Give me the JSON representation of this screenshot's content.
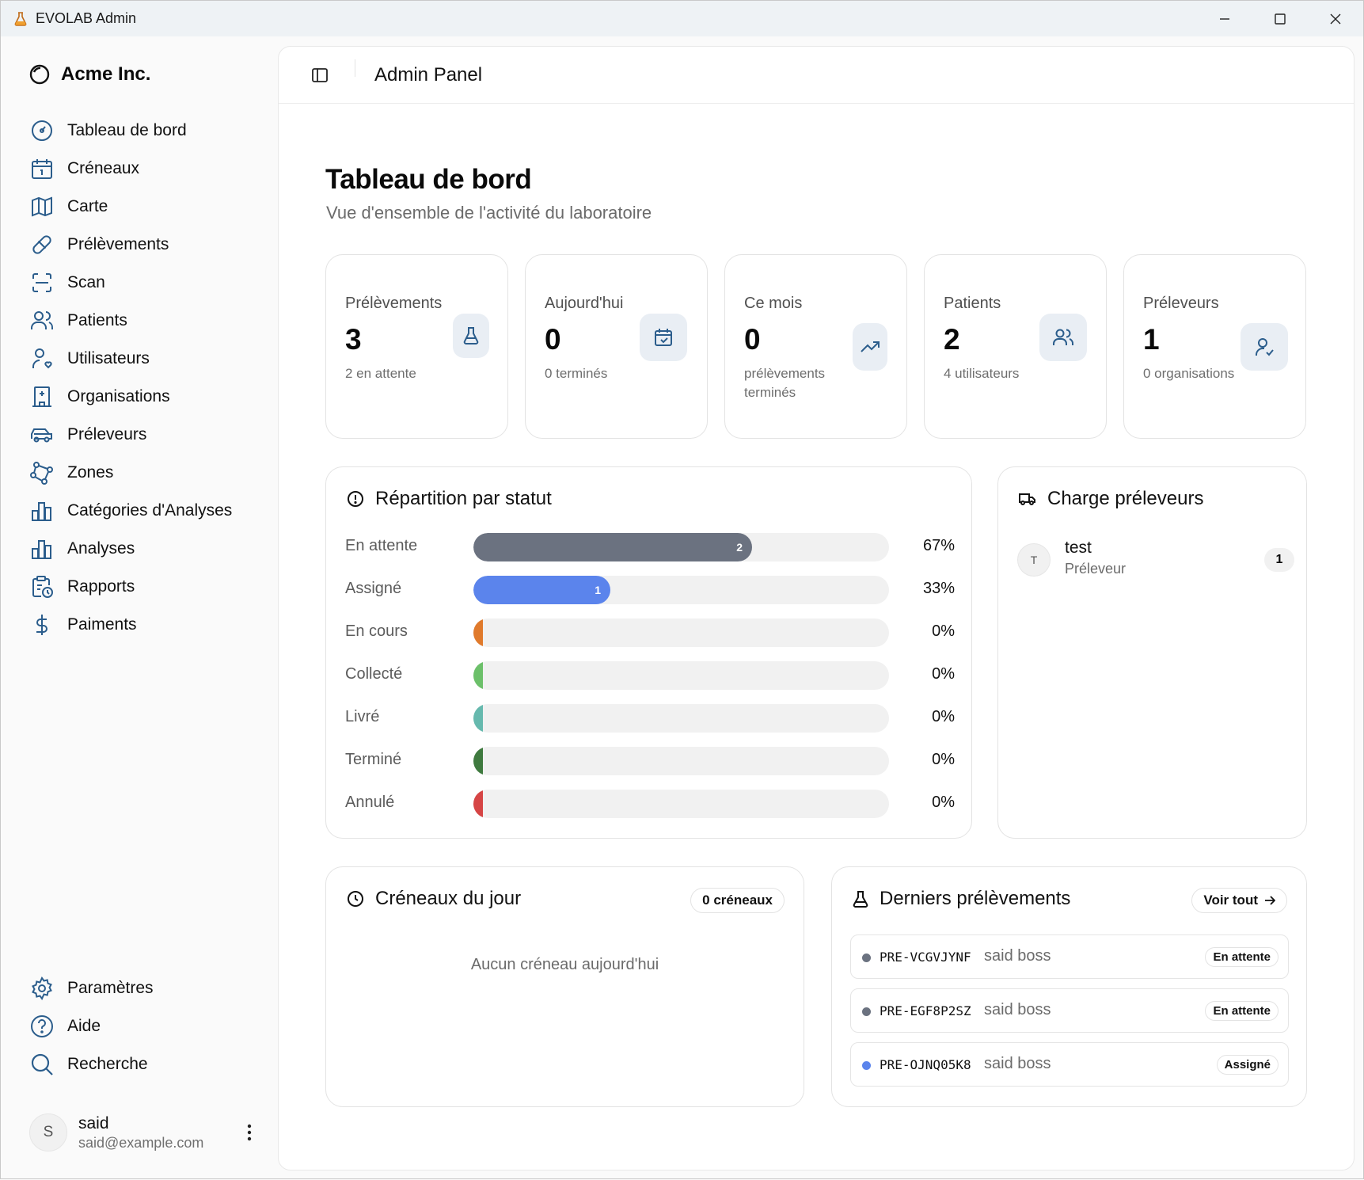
{
  "window": {
    "title": "EVOLAB Admin"
  },
  "sidebar": {
    "brand": "Acme Inc.",
    "items": [
      {
        "label": "Tableau de bord",
        "icon": "gauge-icon"
      },
      {
        "label": "Créneaux",
        "icon": "calendar-icon"
      },
      {
        "label": "Carte",
        "icon": "map-icon"
      },
      {
        "label": "Prélèvements",
        "icon": "pill-icon"
      },
      {
        "label": "Scan",
        "icon": "scan-icon"
      },
      {
        "label": "Patients",
        "icon": "users-icon"
      },
      {
        "label": "Utilisateurs",
        "icon": "user-heart-icon"
      },
      {
        "label": "Organisations",
        "icon": "hospital-icon"
      },
      {
        "label": "Préleveurs",
        "icon": "car-icon"
      },
      {
        "label": "Zones",
        "icon": "polygon-icon"
      },
      {
        "label": "Catégories d'Analyses",
        "icon": "bar-chart-icon"
      },
      {
        "label": "Analyses",
        "icon": "bar-chart-icon"
      },
      {
        "label": "Rapports",
        "icon": "clipboard-clock-icon"
      },
      {
        "label": "Paiments",
        "icon": "dollar-icon"
      }
    ],
    "bottom_items": [
      {
        "label": "Paramètres",
        "icon": "gear-icon"
      },
      {
        "label": "Aide",
        "icon": "help-icon"
      },
      {
        "label": "Recherche",
        "icon": "search-icon"
      }
    ],
    "user": {
      "initial": "S",
      "name": "said",
      "email": "said@example.com"
    }
  },
  "header": {
    "title": "Admin Panel"
  },
  "page": {
    "title": "Tableau de bord",
    "subtitle": "Vue d'ensemble de l'activité du laboratoire"
  },
  "stats": [
    {
      "label": "Prélèvements",
      "value": "3",
      "sub": "2 en attente",
      "icon": "flask-icon"
    },
    {
      "label": "Aujourd'hui",
      "value": "0",
      "sub": "0 terminés",
      "icon": "calendar-check-icon"
    },
    {
      "label": "Ce mois",
      "value": "0",
      "sub": "prélèvements terminés",
      "icon": "trending-up-icon"
    },
    {
      "label": "Patients",
      "value": "2",
      "sub": "4 utilisateurs",
      "icon": "users-icon"
    },
    {
      "label": "Préleveurs",
      "value": "1",
      "sub": "0 organisations",
      "icon": "user-check-icon"
    }
  ],
  "status_breakdown": {
    "title": "Répartition par statut",
    "rows": [
      {
        "label": "En attente",
        "count": "2",
        "fraction": 0.67,
        "percent": "67%",
        "color": "#6b7280"
      },
      {
        "label": "Assigné",
        "count": "1",
        "fraction": 0.33,
        "percent": "33%",
        "color": "#5b84ec"
      },
      {
        "label": "En cours",
        "count": "",
        "fraction": 0,
        "percent": "0%",
        "color": "#e07a2c"
      },
      {
        "label": "Collecté",
        "count": "",
        "fraction": 0,
        "percent": "0%",
        "color": "#6cc06a"
      },
      {
        "label": "Livré",
        "count": "",
        "fraction": 0,
        "percent": "0%",
        "color": "#66b9ae"
      },
      {
        "label": "Terminé",
        "count": "",
        "fraction": 0,
        "percent": "0%",
        "color": "#3f7a3f"
      },
      {
        "label": "Annulé",
        "count": "",
        "fraction": 0,
        "percent": "0%",
        "color": "#d64545"
      }
    ]
  },
  "charge": {
    "title": "Charge préleveurs",
    "items": [
      {
        "initial": "T",
        "name": "test",
        "role": "Préleveur",
        "count": "1"
      }
    ]
  },
  "creneaux": {
    "title": "Créneaux du jour",
    "badge": "0 créneaux",
    "empty": "Aucun créneau aujourd'hui"
  },
  "latest": {
    "title": "Derniers prélèvements",
    "see_all": "Voir tout",
    "rows": [
      {
        "code": "PRE-VCGVJYNF",
        "patient": "said boss",
        "status": "En attente",
        "color": "#6b7280"
      },
      {
        "code": "PRE-EGF8P2SZ",
        "patient": "said boss",
        "status": "En attente",
        "color": "#6b7280"
      },
      {
        "code": "PRE-OJNQ05K8",
        "patient": "said boss",
        "status": "Assigné",
        "color": "#5b84ec"
      }
    ]
  }
}
